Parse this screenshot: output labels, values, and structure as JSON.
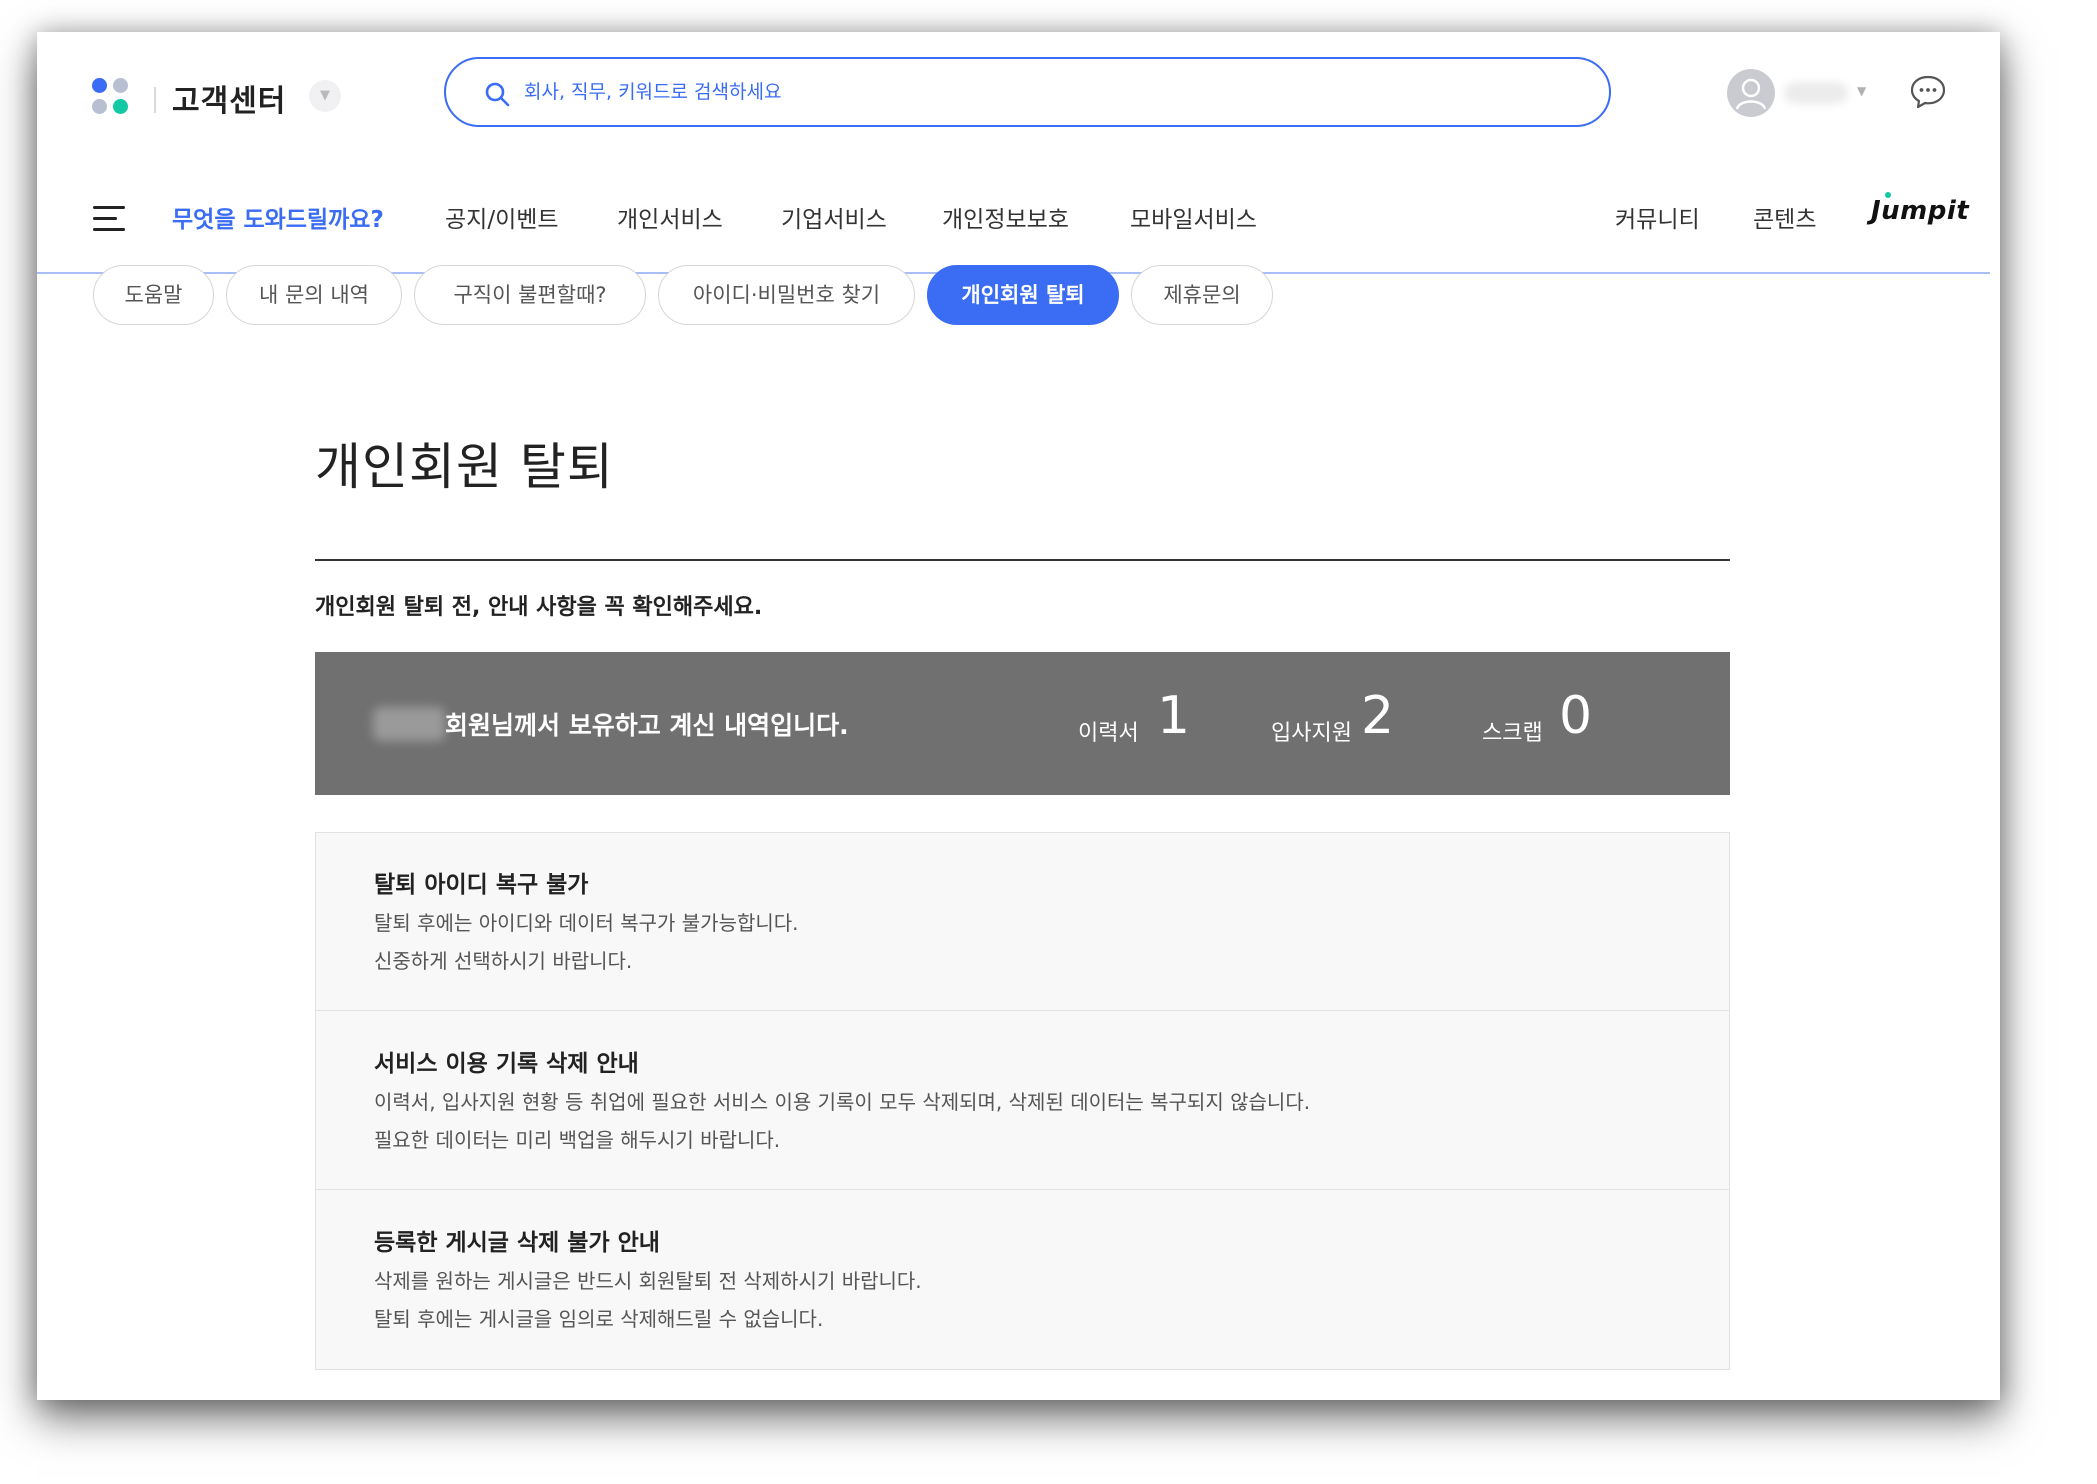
{
  "header": {
    "brand_title": "고객센터",
    "search_placeholder": "회사, 직무, 키워드로 검색하세요"
  },
  "nav": {
    "items": [
      {
        "label": "무엇을 도와드릴까요?",
        "primary": true
      },
      {
        "label": "공지/이벤트"
      },
      {
        "label": "개인서비스"
      },
      {
        "label": "기업서비스"
      },
      {
        "label": "개인정보보호"
      },
      {
        "label": "모바일서비스"
      },
      {
        "label": "커뮤니티"
      },
      {
        "label": "콘텐츠"
      }
    ],
    "jumpit": "Jumpit"
  },
  "tabs": [
    {
      "label": "도움말"
    },
    {
      "label": "내 문의 내역"
    },
    {
      "label": "구직이 불편할때?"
    },
    {
      "label": "아이디·비밀번호 찾기"
    },
    {
      "label": "개인회원 탈퇴",
      "active": true
    },
    {
      "label": "제휴문의"
    }
  ],
  "main": {
    "title": "개인회원 탈퇴",
    "notice": "개인회원 탈퇴 전, 안내 사항을 꼭 확인해주세요.",
    "summary": {
      "text": "회원님께서 보유하고 계신 내역입니다.",
      "stats": [
        {
          "label": "이력서",
          "value": "1"
        },
        {
          "label": "입사지원",
          "value": "2"
        },
        {
          "label": "스크랩",
          "value": "0"
        }
      ]
    },
    "sections": [
      {
        "title": "탈퇴 아이디 복구 불가",
        "lines": [
          "탈퇴 후에는 아이디와 데이터 복구가 불가능합니다.",
          "신중하게 선택하시기 바랍니다."
        ]
      },
      {
        "title": "서비스 이용 기록 삭제 안내",
        "lines": [
          "이력서, 입사지원 현황 등 취업에 필요한 서비스 이용 기록이 모두 삭제되며, 삭제된 데이터는 복구되지 않습니다.",
          "필요한 데이터는 미리 백업을 해두시기 바랍니다."
        ]
      },
      {
        "title": "등록한 게시글 삭제 불가 안내",
        "lines": [
          "삭제를 원하는 게시글은 반드시 회원탈퇴 전 삭제하시기 바랍니다.",
          "탈퇴 후에는 게시글을 임의로 삭제해드릴 수 없습니다."
        ]
      }
    ]
  },
  "colors": {
    "accent": "#3a6cf4",
    "summary_bg": "#707070",
    "info_bg": "#f8f8f8"
  }
}
